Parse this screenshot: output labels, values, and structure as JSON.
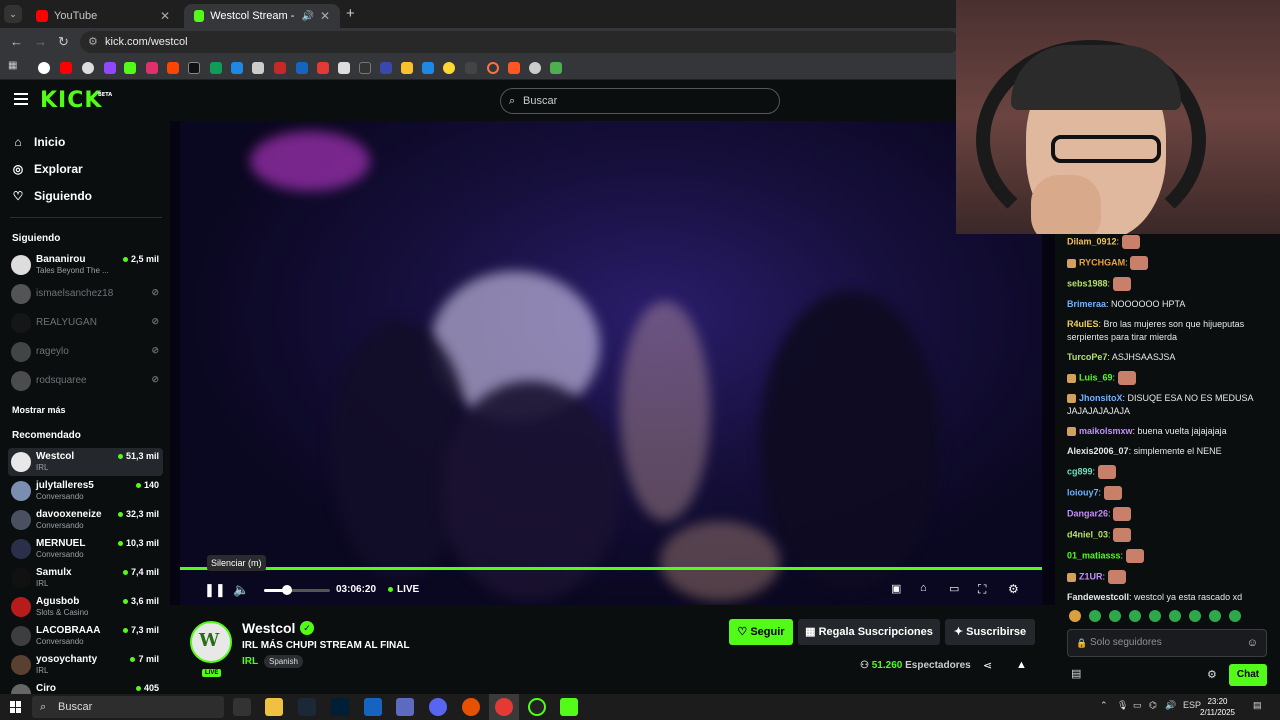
{
  "browser": {
    "tabs": [
      {
        "label": "YouTube",
        "active": false
      },
      {
        "label": "Westcol Stream - Watch Li",
        "active": true
      }
    ],
    "url": "kick.com/westcol"
  },
  "header": {
    "logo": "KICK",
    "logo_badge": "BETA",
    "search_placeholder": "Buscar"
  },
  "sidebar": {
    "nav": [
      {
        "label": "Inicio",
        "icon": "home-icon"
      },
      {
        "label": "Explorar",
        "icon": "compass-icon"
      },
      {
        "label": "Siguiendo",
        "icon": "heart-icon"
      }
    ],
    "following_title": "Siguiendo",
    "following": [
      {
        "name": "Bananirou",
        "category": "Tales Beyond The ...",
        "viewers": "2,5 mil",
        "live": true
      },
      {
        "name": "ismaelsanchez18",
        "live": false
      },
      {
        "name": "REALYUGAN",
        "live": false
      },
      {
        "name": "rageylo",
        "live": false
      },
      {
        "name": "rodsquaree",
        "live": false
      }
    ],
    "show_more": "Mostrar más",
    "recommended_title": "Recomendado",
    "recommended": [
      {
        "name": "Westcol",
        "category": "IRL",
        "viewers": "51,3 mil"
      },
      {
        "name": "julytalleres5",
        "category": "Conversando",
        "viewers": "140"
      },
      {
        "name": "davooxeneize",
        "category": "Conversando",
        "viewers": "32,3 mil"
      },
      {
        "name": "MERNUEL",
        "category": "Conversando",
        "viewers": "10,3 mil"
      },
      {
        "name": "Samulx",
        "category": "IRL",
        "viewers": "7,4 mil"
      },
      {
        "name": "Agusbob",
        "category": "Slots & Casino",
        "viewers": "3,6 mil"
      },
      {
        "name": "LACOBRAAA",
        "category": "Conversando",
        "viewers": "7,3 mil"
      },
      {
        "name": "yosoychanty",
        "category": "IRL",
        "viewers": "7 mil"
      },
      {
        "name": "Ciro",
        "category": "",
        "viewers": "405"
      }
    ]
  },
  "player": {
    "tooltip": "Silenciar (m)",
    "time": "03:06:20",
    "live_label": "LIVE",
    "progress": 1.0,
    "volume": 0.35
  },
  "stream": {
    "channel": "Westcol",
    "title": "IRL MÁS CHUPI STREAM AL FINAL",
    "category": "IRL",
    "language": "Spanish",
    "live_badge": "LIVE",
    "follow_label": "Seguir",
    "gift_label": "Regala Suscripciones",
    "subscribe_label": "Suscribirse",
    "viewers": "51.260",
    "viewers_label": "Espectadores"
  },
  "chat": {
    "messages": [
      {
        "user": "Dilam_0912",
        "color": "#f0c060",
        "text": "",
        "emote": true,
        "badge": false
      },
      {
        "user": "RYCHGAM",
        "color": "#e9a23b",
        "text": "",
        "emote": true,
        "badge": true
      },
      {
        "user": "sebs1988",
        "color": "#b4e06a",
        "text": "",
        "emote": true,
        "badge": false
      },
      {
        "user": "Brimeraa",
        "color": "#6fb3ff",
        "text": "NOOOOOO HPTA",
        "emote": false,
        "badge": false
      },
      {
        "user": "R4ulES",
        "color": "#f0d060",
        "text": "Bro las mujeres son que hijueputas serpientes para tirar mierda",
        "emote": false,
        "badge": false
      },
      {
        "user": "TurcoPe7",
        "color": "#b4e06a",
        "text": "ASJHSAASJSA",
        "emote": false,
        "badge": false
      },
      {
        "user": "Luis_69",
        "color": "#53fc18",
        "text": "",
        "emote": true,
        "badge": true
      },
      {
        "user": "JhonsitoX",
        "color": "#6fb3ff",
        "text": "DISUQE ESA NO ES MEDUSA JAJAJAJAJAJA",
        "emote": false,
        "badge": true
      },
      {
        "user": "maikolsmxw",
        "color": "#c58cff",
        "text": "buena vuelta jajajajaja",
        "emote": false,
        "badge": true
      },
      {
        "user": "Alexis2006_07",
        "color": "#e8e8e8",
        "text": "simplemente el NENE",
        "emote": false,
        "badge": false
      },
      {
        "user": "cg899",
        "color": "#6be0c0",
        "text": "",
        "emote": true,
        "badge": false
      },
      {
        "user": "loiouy7",
        "color": "#6fb3ff",
        "text": "",
        "emote": true,
        "badge": false
      },
      {
        "user": "Dangar26",
        "color": "#c58cff",
        "text": "",
        "emote": true,
        "badge": false
      },
      {
        "user": "d4niel_03",
        "color": "#b4e06a",
        "text": "",
        "emote": true,
        "badge": false
      },
      {
        "user": "01_matiasss",
        "color": "#53fc18",
        "text": "",
        "emote": true,
        "badge": false
      },
      {
        "user": "Z1UR",
        "color": "#c58cff",
        "text": "",
        "emote": true,
        "badge": true
      },
      {
        "user": "Fandewestcoll",
        "color": "#e8e8e8",
        "text": "westcol ya esta rascado xd",
        "emote": false,
        "badge": false
      }
    ],
    "input_placeholder": "Solo seguidores",
    "send_label": "Chat"
  },
  "taskbar": {
    "search_placeholder": "Buscar",
    "lang": "ESP",
    "time": "23:20",
    "date": "2/11/2025"
  }
}
